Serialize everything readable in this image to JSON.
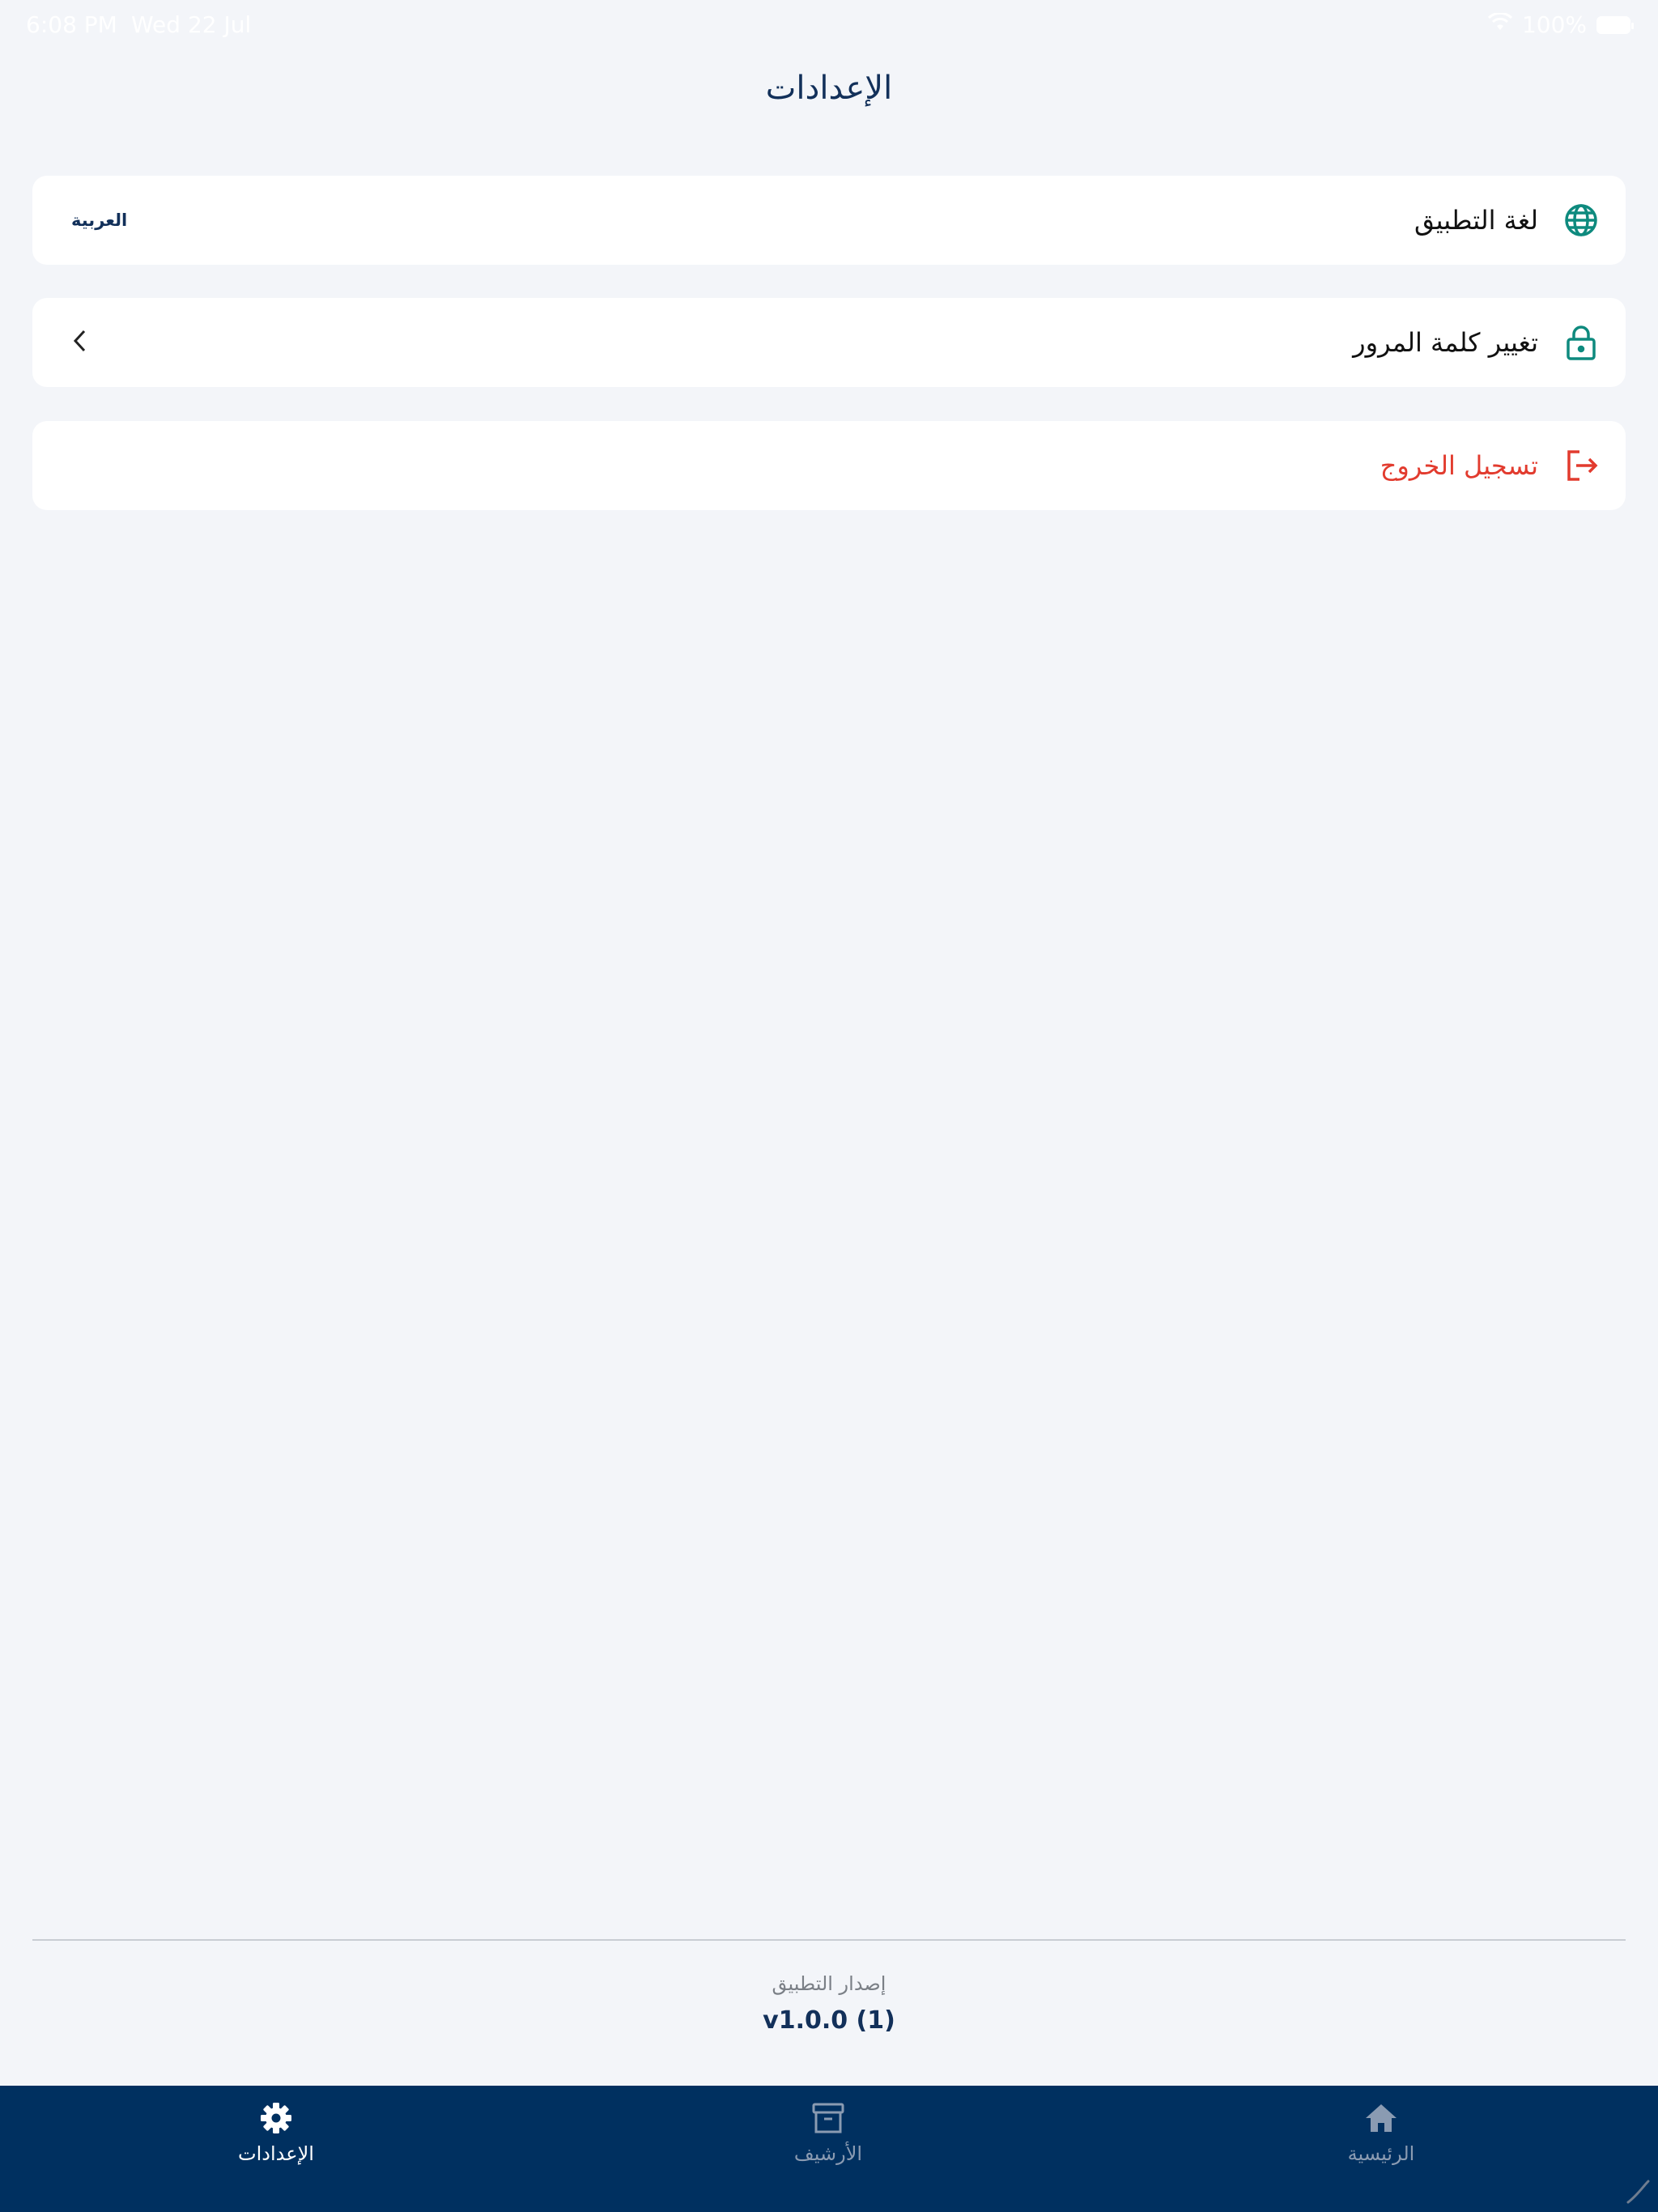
{
  "status_bar": {
    "time": "6:08 PM",
    "date": "Wed 22 Jul",
    "battery": "100%"
  },
  "header": {
    "title": "الإعدادات"
  },
  "settings": {
    "language": {
      "label": "لغة التطبيق",
      "value": "العربية",
      "icon": "globe-icon"
    },
    "password": {
      "label": "تغيير كلمة المرور",
      "icon": "lock-icon",
      "chevron": "chevron-left-icon"
    },
    "logout": {
      "label": "تسجيل الخروج",
      "icon": "logout-icon"
    }
  },
  "footer": {
    "version_label": "إصدار التطبيق",
    "version_value": "v1.0.0 (1)"
  },
  "tab_bar": {
    "tabs": [
      {
        "label": "الإعدادات",
        "icon": "gear-icon",
        "active": true
      },
      {
        "label": "الأرشيف",
        "icon": "archive-icon",
        "active": false
      },
      {
        "label": "الرئيسية",
        "icon": "home-icon",
        "active": false
      }
    ]
  },
  "colors": {
    "background": "#f3f5f9",
    "primary": "#003060",
    "accent_teal": "#0e8a7e",
    "danger": "#e23b2e",
    "title": "#12305a"
  }
}
